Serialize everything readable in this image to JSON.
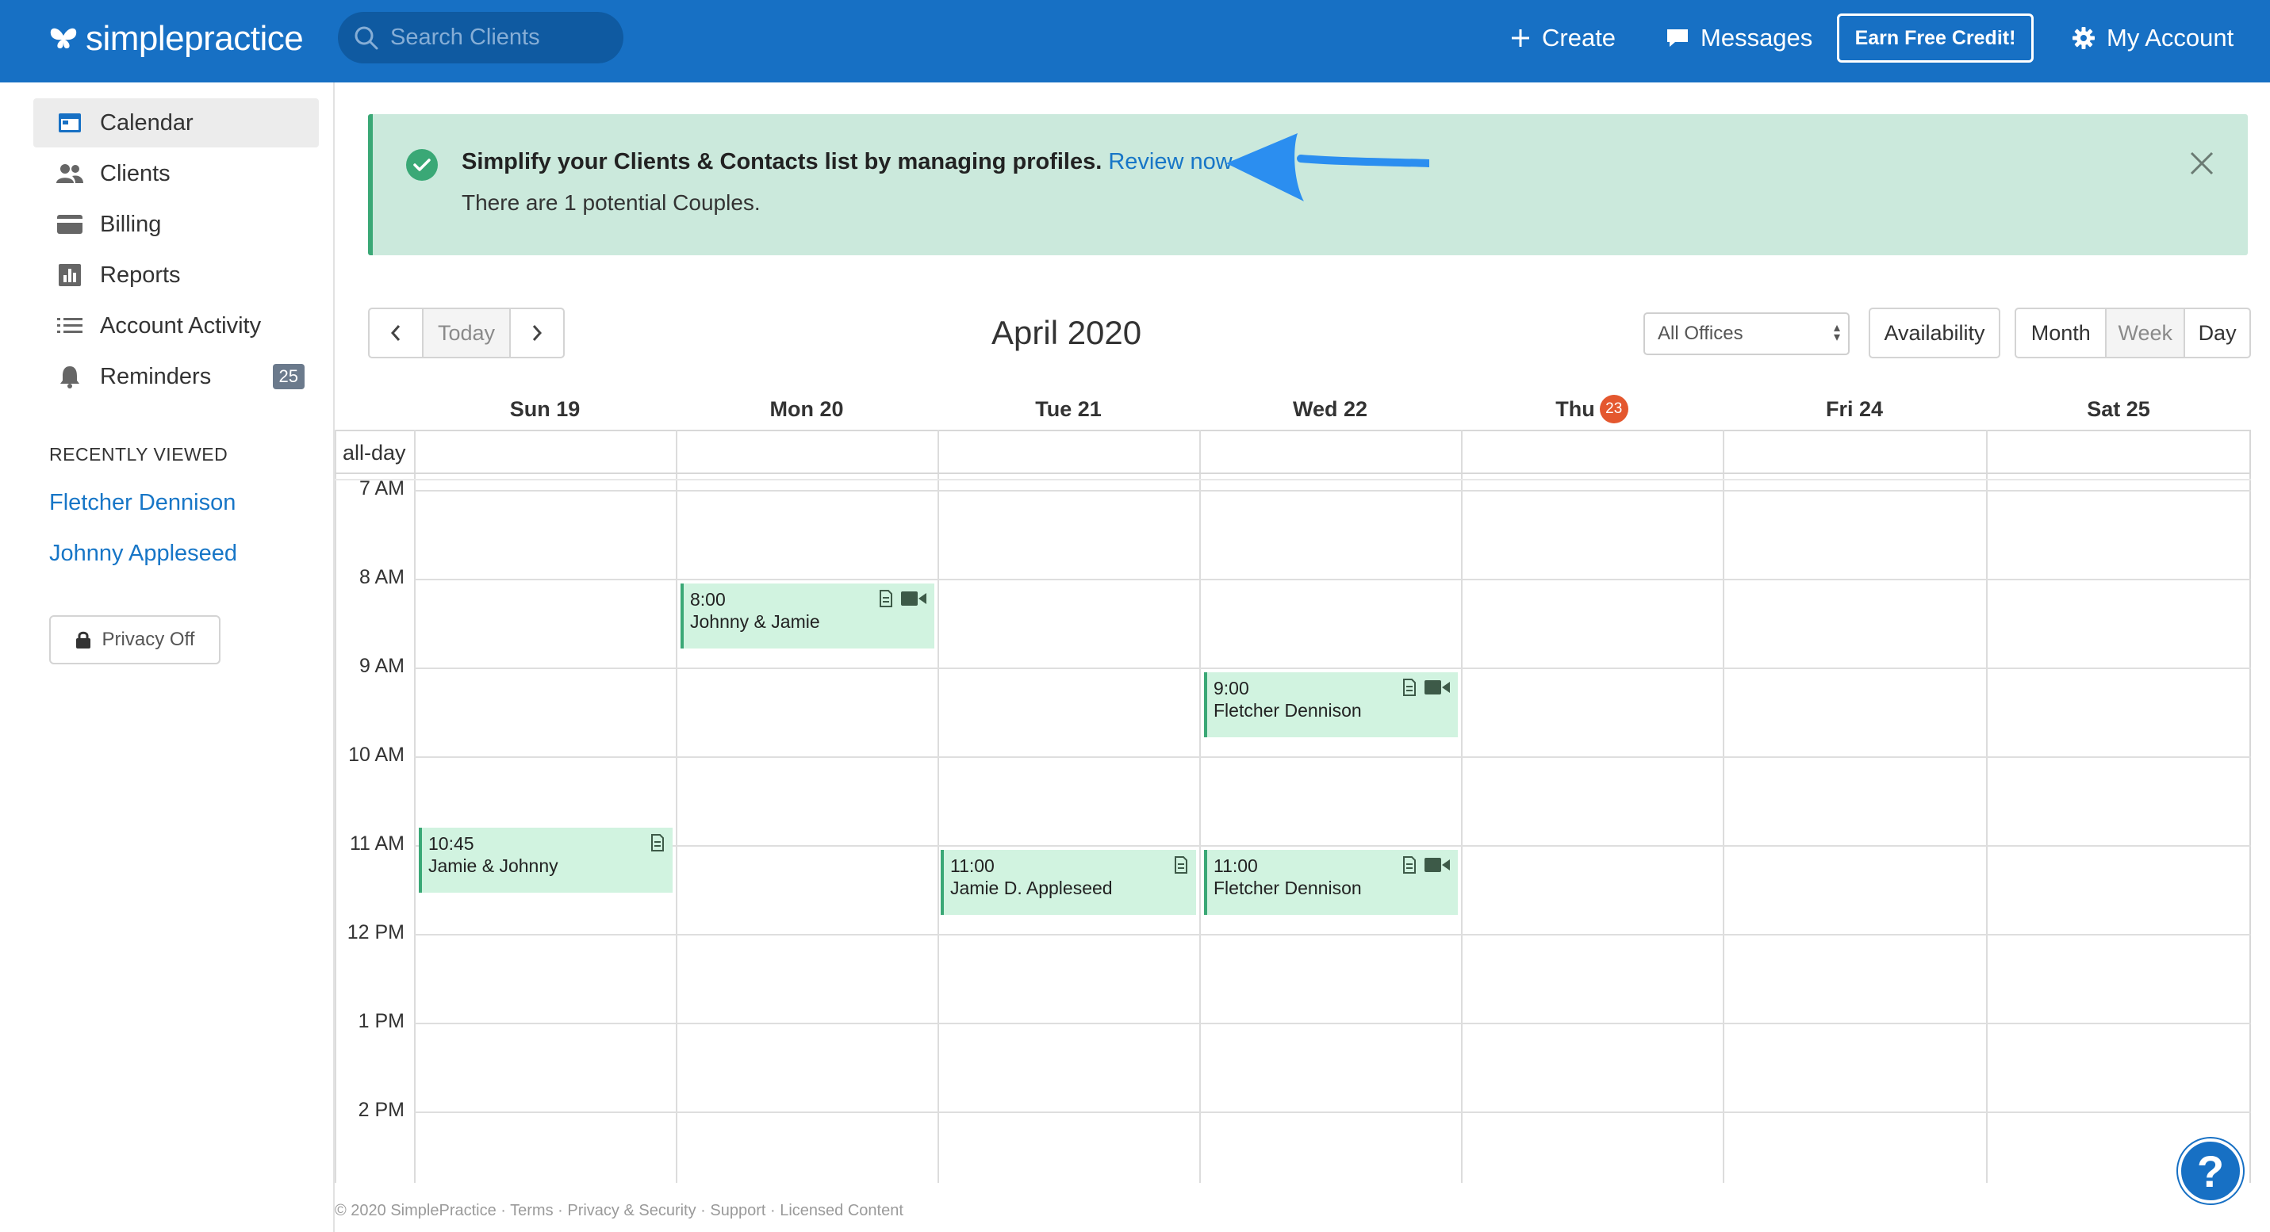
{
  "app": {
    "logo_text": "simplepractice",
    "search_placeholder": "Search Clients"
  },
  "topnav": {
    "create": "Create",
    "messages": "Messages",
    "earn_credit": "Earn Free Credit!",
    "my_account": "My Account"
  },
  "sidebar": {
    "items": [
      {
        "label": "Calendar",
        "icon": "calendar-icon",
        "active": true
      },
      {
        "label": "Clients",
        "icon": "clients-icon"
      },
      {
        "label": "Billing",
        "icon": "credit-card-icon"
      },
      {
        "label": "Reports",
        "icon": "bar-chart-icon"
      },
      {
        "label": "Account Activity",
        "icon": "list-icon"
      },
      {
        "label": "Reminders",
        "icon": "bell-icon",
        "badge": "25"
      }
    ],
    "recent_title": "RECENTLY VIEWED",
    "recent": [
      "Fletcher Dennison",
      "Johnny Appleseed"
    ],
    "privacy_label": "Privacy Off"
  },
  "banner": {
    "message": "Simplify your Clients & Contacts list by managing profiles.",
    "link": "Review now",
    "sub": "There are 1 potential Couples."
  },
  "toolbar": {
    "prev": "‹",
    "today": "Today",
    "next": "›",
    "title": "April 2020",
    "office": "All Offices",
    "availability": "Availability",
    "views": [
      "Month",
      "Week",
      "Day"
    ],
    "active_view": "Week"
  },
  "calendar": {
    "days": [
      "Sun 19",
      "Mon 20",
      "Tue 21",
      "Wed 22",
      "Thu",
      "Fri 24",
      "Sat 25"
    ],
    "today_badge": "23",
    "allday_label": "all-day",
    "hours": [
      "7 AM",
      "8 AM",
      "9 AM",
      "10 AM",
      "11 AM",
      "12 PM",
      "1 PM",
      "2 PM"
    ],
    "events": [
      {
        "time": "8:00",
        "name": "Johnny & Jamie",
        "day": "Mon 20",
        "video": true
      },
      {
        "time": "9:00",
        "name": "Fletcher Dennison",
        "day": "Wed 22",
        "video": true
      },
      {
        "time": "10:45",
        "name": "Jamie & Johnny",
        "day": "Sun 19",
        "video": false
      },
      {
        "time": "11:00",
        "name": "Jamie D. Appleseed",
        "day": "Tue 21",
        "video": false
      },
      {
        "time": "11:00",
        "name": "Fletcher Dennison",
        "day": "Wed 22",
        "video": true
      }
    ]
  },
  "footer": {
    "text": "© 2020 SimplePractice · Terms · Privacy & Security · Support · Licensed Content"
  },
  "help": "?",
  "colors": {
    "brand": "#1770c4",
    "banner_bg": "#cbe9dc",
    "event_bg": "#d1f3e0",
    "event_border": "#3aa876",
    "today_badge": "#e4572e"
  }
}
